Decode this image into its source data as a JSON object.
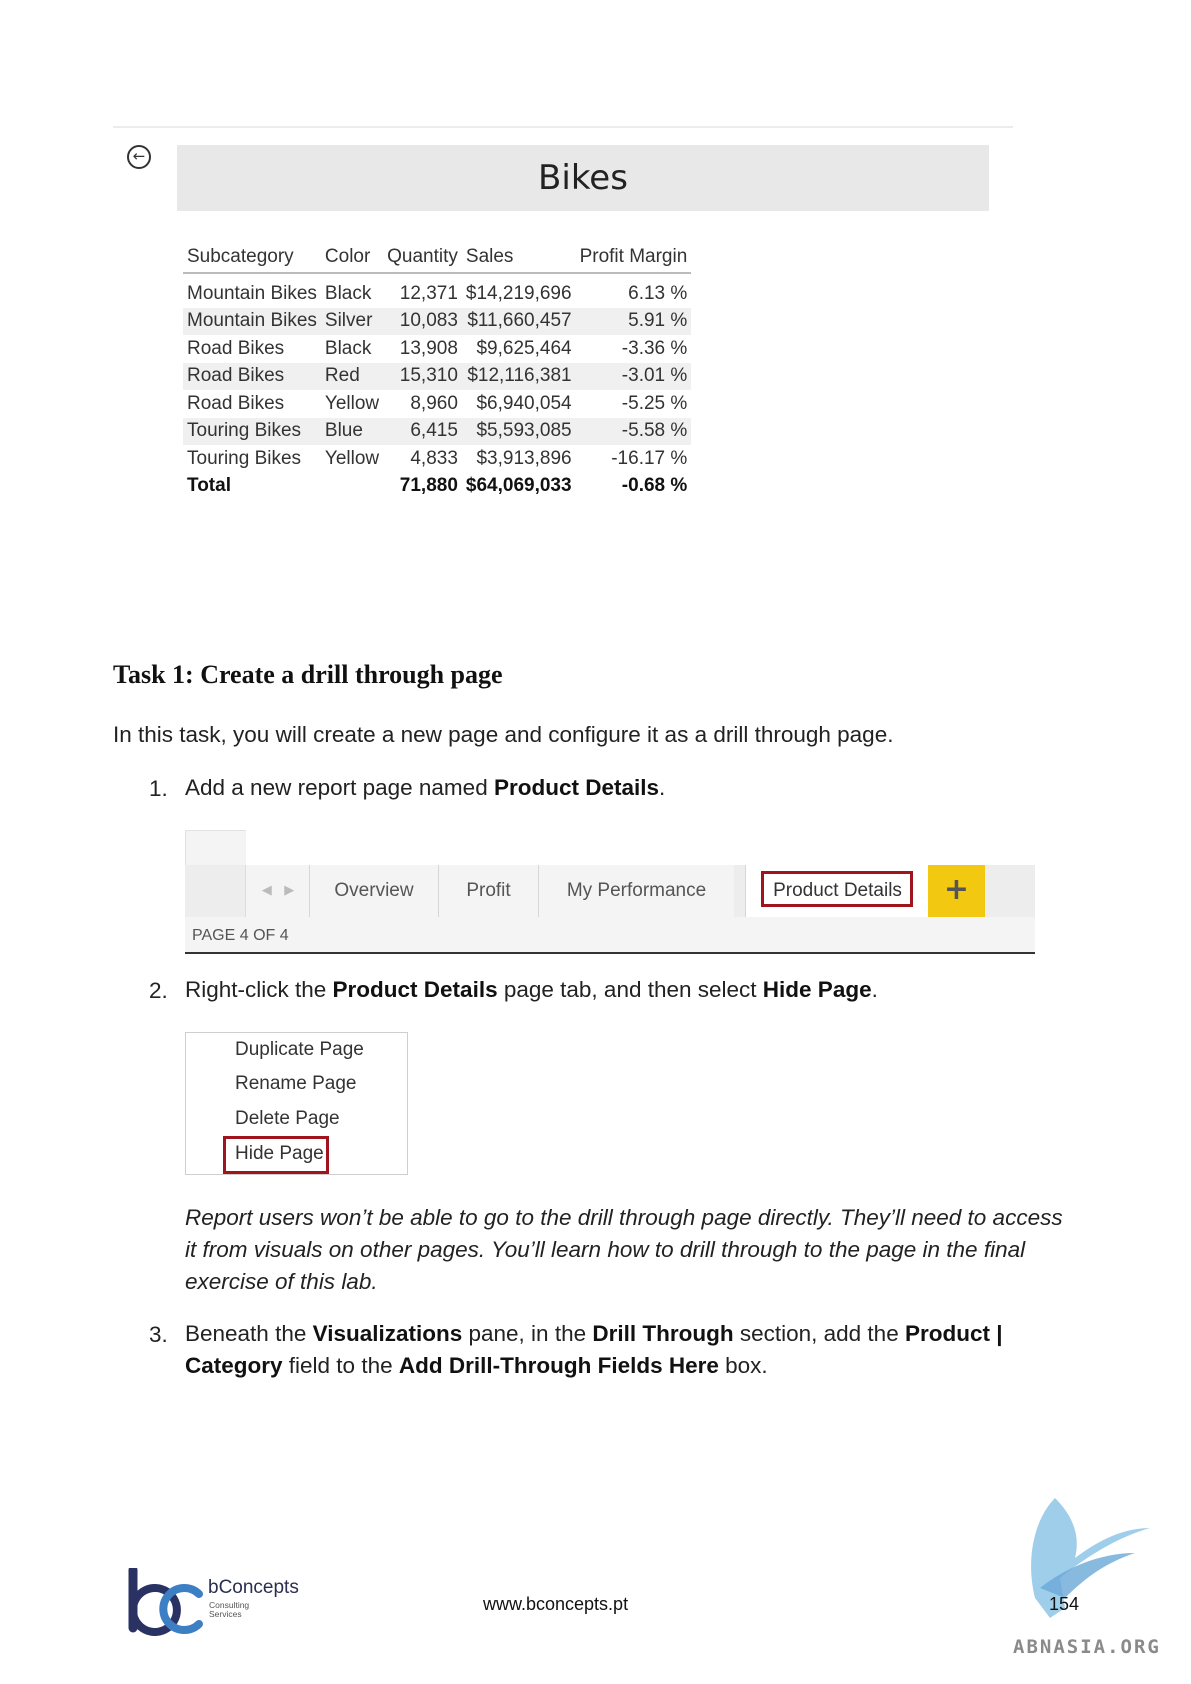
{
  "report": {
    "title": "Bikes",
    "back_icon": "arrow-left-circle-icon",
    "columns": [
      "Subcategory",
      "Color",
      "Quantity",
      "Sales",
      "Profit Margin"
    ],
    "rows": [
      [
        "Mountain Bikes",
        "Black",
        "12,371",
        "$14,219,696",
        "6.13 %"
      ],
      [
        "Mountain Bikes",
        "Silver",
        "10,083",
        "$11,660,457",
        "5.91 %"
      ],
      [
        "Road Bikes",
        "Black",
        "13,908",
        "$9,625,464",
        "-3.36 %"
      ],
      [
        "Road Bikes",
        "Red",
        "15,310",
        "$12,116,381",
        "-3.01 %"
      ],
      [
        "Road Bikes",
        "Yellow",
        "8,960",
        "$6,940,054",
        "-5.25 %"
      ],
      [
        "Touring Bikes",
        "Blue",
        "6,415",
        "$5,593,085",
        "-5.58 %"
      ],
      [
        "Touring Bikes",
        "Yellow",
        "4,833",
        "$3,913,896",
        "-16.17 %"
      ]
    ],
    "total": [
      "Total",
      "",
      "71,880",
      "$64,069,033",
      "-0.68 %"
    ]
  },
  "task": {
    "heading": "Task 1: Create a drill through page",
    "intro": "In this task, you will create a new page and configure it as a drill through page.",
    "step1": {
      "num": "1.",
      "pre": "Add a new report page named ",
      "bold": "Product Details",
      "post": "."
    },
    "step2": {
      "num": "2.",
      "pre": "Right-click the ",
      "bold1": "Product Details",
      "mid": " page tab, and then select ",
      "bold2": "Hide Page",
      "post": "."
    },
    "note": "Report users won’t be able to go to the drill through page directly. They’ll need to access it from visuals on other pages. You’ll learn how to drill through to the page in the final exercise of this lab.",
    "step3": {
      "num": "3.",
      "t1": "Beneath the ",
      "b1": "Visualizations",
      "t2": " pane, in the ",
      "b2": "Drill Through",
      "t3": " section, add the ",
      "b3": "Product | Category",
      "t4": " field to the ",
      "b4": "Add Drill-Through Fields Here",
      "t5": " box."
    }
  },
  "tabbar": {
    "tabs": [
      "Overview",
      "Profit",
      "My Performance",
      "Product Details"
    ],
    "active_tab": "Product Details",
    "add_label": "+",
    "page_indicator": "PAGE 4 OF 4",
    "accent_color": "#f2c811",
    "highlight_color": "#a0141e"
  },
  "context_menu": {
    "items": [
      "Duplicate Page",
      "Rename Page",
      "Delete Page",
      "Hide Page"
    ],
    "highlighted": "Hide Page"
  },
  "footer": {
    "brand": "bConcepts",
    "brand_sub": [
      "Consulting",
      "Services"
    ],
    "website": "www.bconcepts.pt",
    "page_number": "154",
    "watermark": "ABNASIA.ORG"
  }
}
